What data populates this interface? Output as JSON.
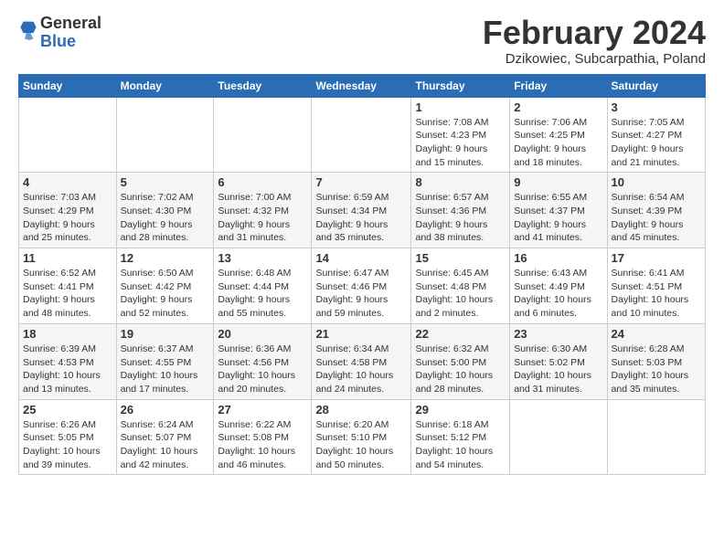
{
  "logo": {
    "general": "General",
    "blue": "Blue"
  },
  "header": {
    "month": "February 2024",
    "location": "Dzikowiec, Subcarpathia, Poland"
  },
  "days_of_week": [
    "Sunday",
    "Monday",
    "Tuesday",
    "Wednesday",
    "Thursday",
    "Friday",
    "Saturday"
  ],
  "weeks": [
    [
      {
        "day": "",
        "info": ""
      },
      {
        "day": "",
        "info": ""
      },
      {
        "day": "",
        "info": ""
      },
      {
        "day": "",
        "info": ""
      },
      {
        "day": "1",
        "info": "Sunrise: 7:08 AM\nSunset: 4:23 PM\nDaylight: 9 hours\nand 15 minutes."
      },
      {
        "day": "2",
        "info": "Sunrise: 7:06 AM\nSunset: 4:25 PM\nDaylight: 9 hours\nand 18 minutes."
      },
      {
        "day": "3",
        "info": "Sunrise: 7:05 AM\nSunset: 4:27 PM\nDaylight: 9 hours\nand 21 minutes."
      }
    ],
    [
      {
        "day": "4",
        "info": "Sunrise: 7:03 AM\nSunset: 4:29 PM\nDaylight: 9 hours\nand 25 minutes."
      },
      {
        "day": "5",
        "info": "Sunrise: 7:02 AM\nSunset: 4:30 PM\nDaylight: 9 hours\nand 28 minutes."
      },
      {
        "day": "6",
        "info": "Sunrise: 7:00 AM\nSunset: 4:32 PM\nDaylight: 9 hours\nand 31 minutes."
      },
      {
        "day": "7",
        "info": "Sunrise: 6:59 AM\nSunset: 4:34 PM\nDaylight: 9 hours\nand 35 minutes."
      },
      {
        "day": "8",
        "info": "Sunrise: 6:57 AM\nSunset: 4:36 PM\nDaylight: 9 hours\nand 38 minutes."
      },
      {
        "day": "9",
        "info": "Sunrise: 6:55 AM\nSunset: 4:37 PM\nDaylight: 9 hours\nand 41 minutes."
      },
      {
        "day": "10",
        "info": "Sunrise: 6:54 AM\nSunset: 4:39 PM\nDaylight: 9 hours\nand 45 minutes."
      }
    ],
    [
      {
        "day": "11",
        "info": "Sunrise: 6:52 AM\nSunset: 4:41 PM\nDaylight: 9 hours\nand 48 minutes."
      },
      {
        "day": "12",
        "info": "Sunrise: 6:50 AM\nSunset: 4:42 PM\nDaylight: 9 hours\nand 52 minutes."
      },
      {
        "day": "13",
        "info": "Sunrise: 6:48 AM\nSunset: 4:44 PM\nDaylight: 9 hours\nand 55 minutes."
      },
      {
        "day": "14",
        "info": "Sunrise: 6:47 AM\nSunset: 4:46 PM\nDaylight: 9 hours\nand 59 minutes."
      },
      {
        "day": "15",
        "info": "Sunrise: 6:45 AM\nSunset: 4:48 PM\nDaylight: 10 hours\nand 2 minutes."
      },
      {
        "day": "16",
        "info": "Sunrise: 6:43 AM\nSunset: 4:49 PM\nDaylight: 10 hours\nand 6 minutes."
      },
      {
        "day": "17",
        "info": "Sunrise: 6:41 AM\nSunset: 4:51 PM\nDaylight: 10 hours\nand 10 minutes."
      }
    ],
    [
      {
        "day": "18",
        "info": "Sunrise: 6:39 AM\nSunset: 4:53 PM\nDaylight: 10 hours\nand 13 minutes."
      },
      {
        "day": "19",
        "info": "Sunrise: 6:37 AM\nSunset: 4:55 PM\nDaylight: 10 hours\nand 17 minutes."
      },
      {
        "day": "20",
        "info": "Sunrise: 6:36 AM\nSunset: 4:56 PM\nDaylight: 10 hours\nand 20 minutes."
      },
      {
        "day": "21",
        "info": "Sunrise: 6:34 AM\nSunset: 4:58 PM\nDaylight: 10 hours\nand 24 minutes."
      },
      {
        "day": "22",
        "info": "Sunrise: 6:32 AM\nSunset: 5:00 PM\nDaylight: 10 hours\nand 28 minutes."
      },
      {
        "day": "23",
        "info": "Sunrise: 6:30 AM\nSunset: 5:02 PM\nDaylight: 10 hours\nand 31 minutes."
      },
      {
        "day": "24",
        "info": "Sunrise: 6:28 AM\nSunset: 5:03 PM\nDaylight: 10 hours\nand 35 minutes."
      }
    ],
    [
      {
        "day": "25",
        "info": "Sunrise: 6:26 AM\nSunset: 5:05 PM\nDaylight: 10 hours\nand 39 minutes."
      },
      {
        "day": "26",
        "info": "Sunrise: 6:24 AM\nSunset: 5:07 PM\nDaylight: 10 hours\nand 42 minutes."
      },
      {
        "day": "27",
        "info": "Sunrise: 6:22 AM\nSunset: 5:08 PM\nDaylight: 10 hours\nand 46 minutes."
      },
      {
        "day": "28",
        "info": "Sunrise: 6:20 AM\nSunset: 5:10 PM\nDaylight: 10 hours\nand 50 minutes."
      },
      {
        "day": "29",
        "info": "Sunrise: 6:18 AM\nSunset: 5:12 PM\nDaylight: 10 hours\nand 54 minutes."
      },
      {
        "day": "",
        "info": ""
      },
      {
        "day": "",
        "info": ""
      }
    ]
  ]
}
